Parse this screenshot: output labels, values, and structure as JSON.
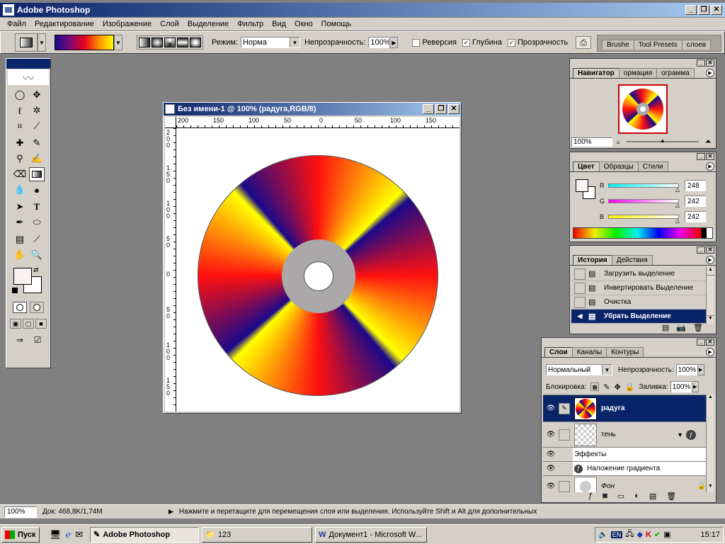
{
  "app": {
    "title": "Adobe Photoshop"
  },
  "menu": [
    "Файл",
    "Редактирование",
    "Изображение",
    "Слой",
    "Выделение",
    "Фильтр",
    "Вид",
    "Окно",
    "Помощь"
  ],
  "options": {
    "mode_label": "Режим:",
    "mode_value": "Норма",
    "opacity_label": "Непрозрачность:",
    "opacity_value": "100%",
    "reverse_label": "Реверсия",
    "dither_label": "Глубина",
    "transparency_label": "Прозрачность",
    "well_tabs": [
      "Brushe",
      "Tool Presets",
      "слоев"
    ]
  },
  "document": {
    "title": "Без имени-1 @ 100% (радуга,RGB/8)",
    "ruler_h": [
      "200",
      "150",
      "100",
      "50",
      "0",
      "50",
      "100",
      "150"
    ],
    "ruler_v": [
      "2\n0\n0",
      "1\n5\n0",
      "1\n0\n0",
      "5\n0",
      "0",
      "5\n0",
      "1\n0\n0",
      "1\n5\n0"
    ]
  },
  "navigator": {
    "tabs": [
      "Навигатор",
      "ормация",
      "ограмма"
    ],
    "zoom": "100%"
  },
  "color": {
    "tabs": [
      "Цвет",
      "Образцы",
      "Стили"
    ],
    "channels": [
      {
        "label": "R",
        "value": "248"
      },
      {
        "label": "G",
        "value": "242"
      },
      {
        "label": "B",
        "value": "242"
      }
    ]
  },
  "history": {
    "tabs": [
      "История",
      "Действия"
    ],
    "items": [
      "Загрузить выделение",
      "Инвертировать Выделение",
      "Очистка",
      "Убрать Выделение"
    ]
  },
  "layers": {
    "tabs": [
      "Слои",
      "Каналы",
      "Контуры"
    ],
    "blend": "Нормальный",
    "opacity_label": "Непрозрачность:",
    "opacity_value": "100%",
    "lock_label": "Блокировка:",
    "fill_label": "Заливка:",
    "fill_value": "100%",
    "items": [
      {
        "name": "радуга"
      },
      {
        "name": "тень"
      },
      {
        "name": "Эффекты"
      },
      {
        "name": "Наложение градиента"
      },
      {
        "name": "Фон"
      }
    ]
  },
  "status": {
    "zoom": "100%",
    "doc": "Док: 468,8K/1,74M",
    "hint": "Нажмите и перетащите для перемещения слоя или выделения. Используйте Shift и Alt для дополнительных"
  },
  "taskbar": {
    "start": "Пуск",
    "tasks": [
      "Adobe Photoshop",
      "123",
      "Документ1 - Microsoft W..."
    ],
    "lang": "EN",
    "clock": "15:17"
  },
  "colors": {
    "titlebar": "#0a246a",
    "face": "#d4d0c8",
    "workspace": "#808080",
    "selection": "#0a246a"
  }
}
